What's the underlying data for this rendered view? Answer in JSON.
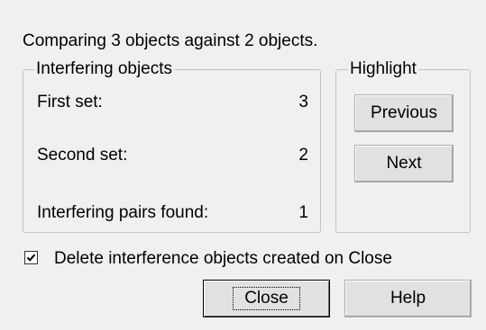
{
  "summary_text": "Comparing 3 objects against 2 objects.",
  "interfering_group": {
    "legend": "Interfering objects",
    "rows": [
      {
        "label": "First set:",
        "value": "3"
      },
      {
        "label": "Second set:",
        "value": "2"
      },
      {
        "label": "Interfering pairs found:",
        "value": "1"
      }
    ]
  },
  "highlight_group": {
    "legend": "Highlight",
    "previous_label": "Previous",
    "next_label": "Next"
  },
  "delete_checkbox": {
    "label": "Delete interference objects created on Close",
    "checked": true
  },
  "buttons": {
    "close_label": "Close",
    "help_label": "Help"
  },
  "colors": {
    "dialog_bg": "#f0f0f0",
    "group_border": "#c4c4c4",
    "button_face": "#e1e1e1"
  },
  "icons": {
    "checkbox_mark": "check-mark-icon"
  }
}
